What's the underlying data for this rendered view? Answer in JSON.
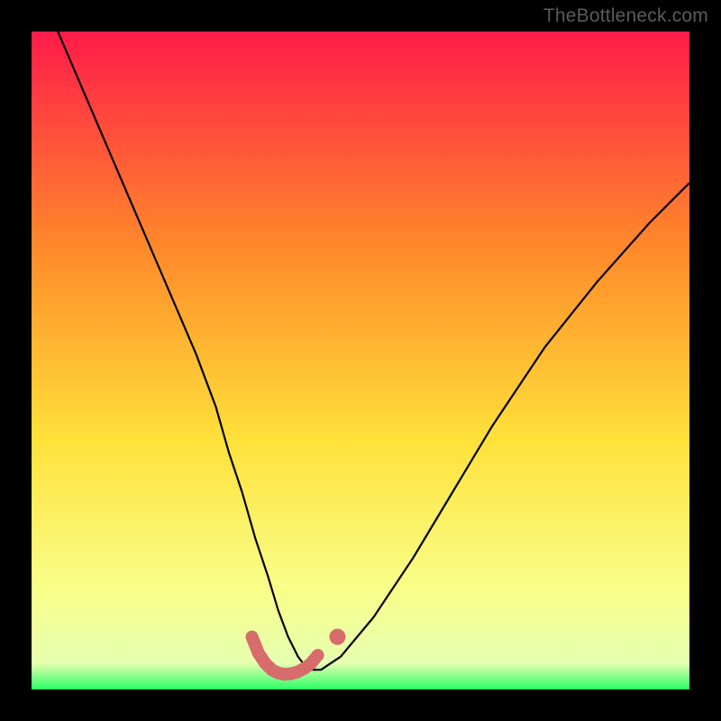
{
  "watermark": "TheBottleneck.com",
  "chart_data": {
    "type": "line",
    "title": "",
    "xlabel": "",
    "ylabel": "",
    "xlim": [
      0,
      100
    ],
    "ylim": [
      0,
      100
    ],
    "series": [
      {
        "name": "bottleneck-curve",
        "x": [
          4,
          7,
          10,
          13,
          16,
          19,
          22,
          25,
          28,
          30,
          32,
          34,
          36,
          37.5,
          39,
          40.5,
          42,
          44,
          47,
          52,
          58,
          64,
          70,
          78,
          86,
          94,
          100
        ],
        "y": [
          100,
          93,
          86,
          79,
          72,
          65,
          58,
          51,
          43,
          36,
          30,
          23,
          17,
          12,
          8,
          5,
          3,
          3,
          5,
          11,
          20,
          30,
          40,
          52,
          62,
          71,
          77
        ]
      },
      {
        "name": "highlight-segment",
        "x": [
          33.5,
          34.5,
          35.5,
          36.5,
          37.5,
          38.5,
          39.5,
          40.5,
          41.5,
          42.5,
          43.5
        ],
        "y": [
          8,
          5.5,
          4,
          3,
          2.5,
          2.3,
          2.4,
          2.7,
          3.2,
          4,
          5.2
        ]
      },
      {
        "name": "highlight-dot",
        "x": [
          46.5
        ],
        "y": [
          8.0
        ]
      }
    ],
    "colors": {
      "gradient_top": "#ff1b4a",
      "gradient_mid_upper": "#ff8a2a",
      "gradient_mid": "#ffe13a",
      "gradient_lower": "#f8ff8a",
      "gradient_bottom": "#2bff66",
      "curve": "#000000",
      "highlight": "#d86b6b",
      "frame": "#000000"
    }
  }
}
